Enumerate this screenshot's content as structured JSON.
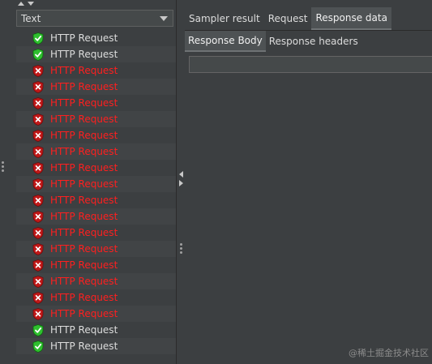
{
  "left": {
    "renderer": {
      "selected": "Text"
    },
    "results": [
      {
        "label": "HTTP Request",
        "status": "success",
        "icon": "success-shield-icon"
      },
      {
        "label": "HTTP Request",
        "status": "success",
        "icon": "success-shield-icon"
      },
      {
        "label": "HTTP Request",
        "status": "failure",
        "icon": "error-shield-icon"
      },
      {
        "label": "HTTP Request",
        "status": "failure",
        "icon": "error-shield-icon"
      },
      {
        "label": "HTTP Request",
        "status": "failure",
        "icon": "error-shield-icon"
      },
      {
        "label": "HTTP Request",
        "status": "failure",
        "icon": "error-shield-icon"
      },
      {
        "label": "HTTP Request",
        "status": "failure",
        "icon": "error-shield-icon"
      },
      {
        "label": "HTTP Request",
        "status": "failure",
        "icon": "error-shield-icon"
      },
      {
        "label": "HTTP Request",
        "status": "failure",
        "icon": "error-shield-icon"
      },
      {
        "label": "HTTP Request",
        "status": "failure",
        "icon": "error-shield-icon"
      },
      {
        "label": "HTTP Request",
        "status": "failure",
        "icon": "error-shield-icon"
      },
      {
        "label": "HTTP Request",
        "status": "failure",
        "icon": "error-shield-icon"
      },
      {
        "label": "HTTP Request",
        "status": "failure",
        "icon": "error-shield-icon"
      },
      {
        "label": "HTTP Request",
        "status": "failure",
        "icon": "error-shield-icon"
      },
      {
        "label": "HTTP Request",
        "status": "failure",
        "icon": "error-shield-icon"
      },
      {
        "label": "HTTP Request",
        "status": "failure",
        "icon": "error-shield-icon"
      },
      {
        "label": "HTTP Request",
        "status": "failure",
        "icon": "error-shield-icon"
      },
      {
        "label": "HTTP Request",
        "status": "failure",
        "icon": "error-shield-icon"
      },
      {
        "label": "HTTP Request",
        "status": "success",
        "icon": "success-shield-icon"
      },
      {
        "label": "HTTP Request",
        "status": "success",
        "icon": "success-shield-icon"
      }
    ]
  },
  "right": {
    "tabs": [
      {
        "label": "Sampler result",
        "active": false
      },
      {
        "label": "Request",
        "active": false
      },
      {
        "label": "Response data",
        "active": true
      }
    ],
    "subtabs": [
      {
        "label": "Response Body",
        "active": true
      },
      {
        "label": "Response headers",
        "active": false
      }
    ],
    "body_field": {
      "value": ""
    }
  },
  "watermark": "@稀土掘金技术社区",
  "colors": {
    "background": "#3c3f41",
    "success": "#2fbf2f",
    "failure": "#ff1f1f",
    "failure_icon": "#c01818",
    "text": "#dcdcdc"
  }
}
